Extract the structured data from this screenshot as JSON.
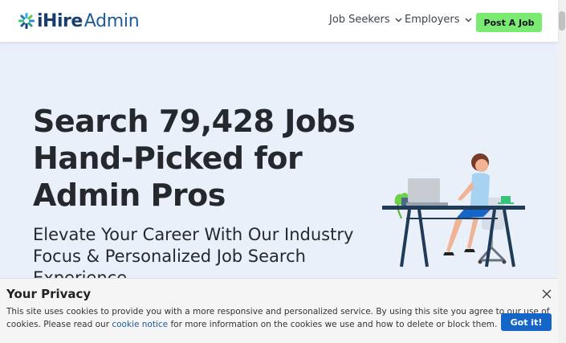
{
  "header": {
    "logo_ihire": "iHire",
    "logo_admin": "Admin",
    "nav": [
      {
        "label": "Job Seekers"
      },
      {
        "label": "Employers"
      }
    ],
    "post_job_label": "Post A Job"
  },
  "hero": {
    "title_lines": [
      "Search 79,428 Jobs",
      "Hand-Picked for",
      "Admin Pros"
    ],
    "subtitle_lines": [
      "Elevate Your Career With Our Industry",
      "Focus & Personalized Job Search",
      "Experience"
    ]
  },
  "cookie": {
    "title": "Your Privacy",
    "text_line1": "This site uses cookies to provide you with a more responsive and personalized service. By using this site you agree to our use of",
    "text_line2_before": "cookies. Please read our ",
    "link_label": "cookie notice",
    "text_line2_after": " for more information on the cookies we use and how to delete or block them.",
    "button_label": "Got it!"
  },
  "colors": {
    "accent_green": "#7bea72",
    "brand_navy": "#1a3f6e",
    "hero_bg": "#eaf0fa",
    "button_blue": "#1565c8"
  },
  "icons": [
    "ihire-logo-icon",
    "chevron-down-icon",
    "close-icon"
  ]
}
